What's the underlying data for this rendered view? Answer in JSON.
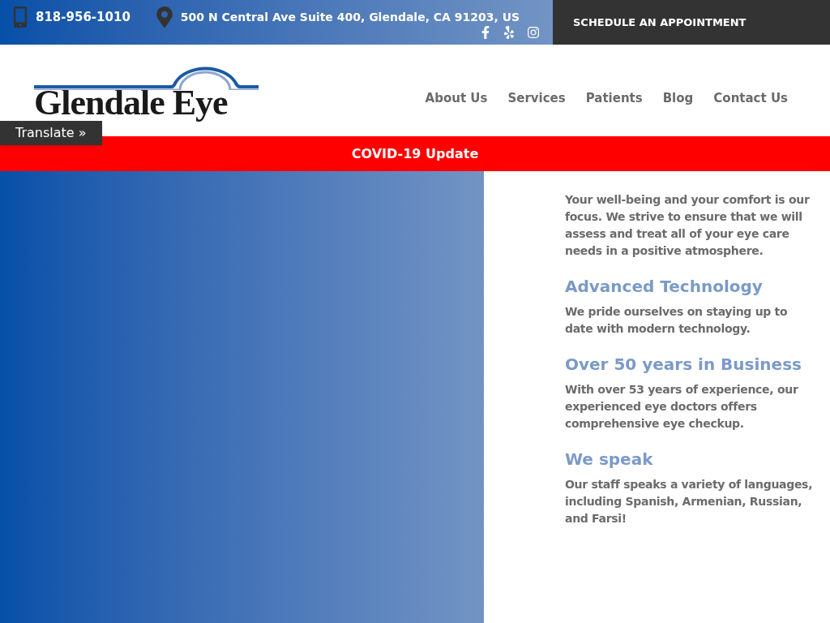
{
  "top_bar": {
    "phone": "818-956-1010",
    "address": "500 N Central Ave Suite 400, Glendale, CA 91203, US",
    "cta": "SCHEDULE AN APPOINTMENT"
  },
  "logo": {
    "text": "Glendale Eye"
  },
  "nav": [
    {
      "label": "About Us"
    },
    {
      "label": "Services"
    },
    {
      "label": "Patients"
    },
    {
      "label": "Blog"
    },
    {
      "label": "Contact Us"
    }
  ],
  "translate": "Translate »",
  "banner": "COVID-19 Update",
  "features": [
    {
      "text": "Your well-being and your comfort is our focus. We strive to ensure that we will assess and treat all of your eye care needs in a positive atmosphere."
    },
    {
      "title": "Advanced Technology",
      "text": "We pride ourselves on staying up to date with modern technology."
    },
    {
      "title": "Over 50 years in Business",
      "text": "With over 53 years of experience, our experienced eye doctors offers comprehensive eye checkup."
    },
    {
      "title": "We speak",
      "text": "Our staff speaks a variety of languages, including Spanish, Armenian, Russian, and Farsi!"
    }
  ]
}
